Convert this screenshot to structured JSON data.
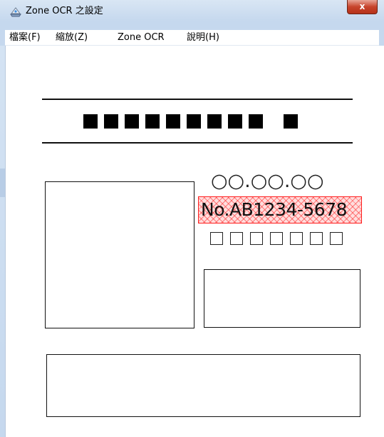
{
  "window": {
    "title": "Zone OCR 之設定",
    "close_glyph": "x"
  },
  "menubar": {
    "items": [
      {
        "label": "檔案(F)"
      },
      {
        "label": "縮放(Z)"
      },
      {
        "label": "Zone OCR"
      },
      {
        "label": "說明(H)"
      }
    ]
  },
  "document": {
    "circles_text": "○○.○○.○○",
    "selected_zone_text": "No.AB1234-5678",
    "black_squares_count": 10,
    "small_squares_count": 7,
    "zone_highlight_color": "#ff2020"
  }
}
